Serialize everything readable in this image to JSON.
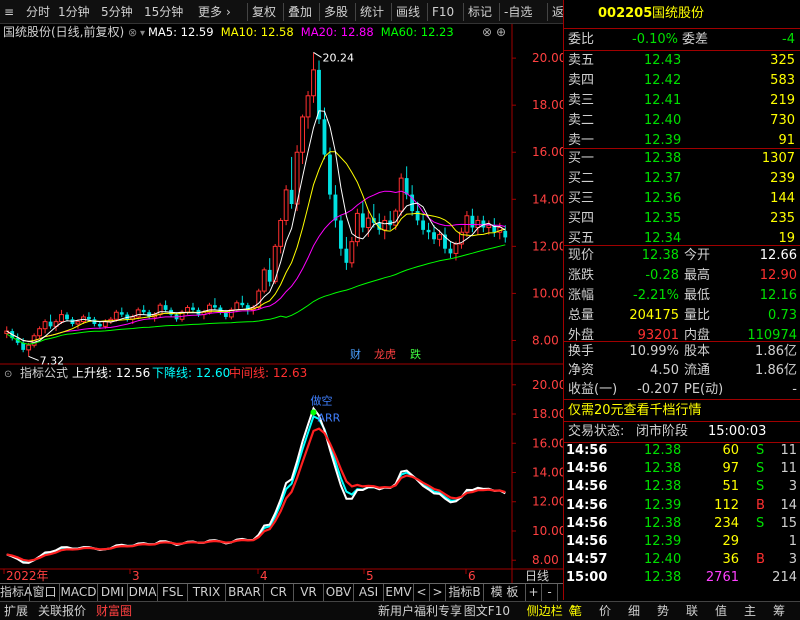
{
  "toolbar": {
    "left": [
      "分时",
      "1分钟",
      "5分钟",
      "15分钟",
      "更多"
    ],
    "right": [
      "复权",
      "叠加",
      "多股",
      "统计",
      "画线",
      "F10",
      "标记",
      "-自选",
      "返回"
    ]
  },
  "main_chart": {
    "title": "国统股份(日线,前复权)",
    "ma": [
      {
        "label": "MA5:",
        "value": "12.59",
        "color": "#ffffff"
      },
      {
        "label": "MA10:",
        "value": "12.58",
        "color": "#ffff00"
      },
      {
        "label": "MA20:",
        "value": "12.88",
        "color": "#ff00ff"
      },
      {
        "label": "MA60:",
        "value": "12.23",
        "color": "#00ff00"
      }
    ],
    "y_ticks": [
      "20.00",
      "18.00",
      "16.00",
      "14.00",
      "12.00",
      "10.00",
      "8.00"
    ],
    "high_label": "20.24",
    "low_label": "7.32",
    "badges": [
      {
        "text": "财",
        "color": "#4aa0ff"
      },
      {
        "text": "龙虎",
        "color": "#ff4040"
      },
      {
        "text": "跌",
        "color": "#40ff40"
      }
    ]
  },
  "indicator": {
    "name": "指标公式",
    "up_label": "上升线:",
    "up_value": "12.56",
    "down_label": "下降线:",
    "down_value": "12.60",
    "mid_label": "中间线:",
    "mid_value": "12.63",
    "y_ticks": [
      "20.00",
      "18.00",
      "16.00",
      "14.00",
      "12.00",
      "10.00",
      "8.00"
    ],
    "annot1": "做空",
    "annot2": "ARR"
  },
  "x_axis": {
    "labels": [
      "2022年",
      "3",
      "4",
      "5",
      "6"
    ],
    "period_button": "日线"
  },
  "tabs": [
    "指标A",
    "窗口",
    "MACD",
    "DMI",
    "DMA",
    "FSL",
    "TRIX",
    "BRAR",
    "CR",
    "VR",
    "OBV",
    "ASI",
    "EMV",
    "<",
    ">",
    "指标B",
    "模 板",
    "+",
    "-"
  ],
  "status_left": [
    "扩展",
    "关联报价",
    "财富圈"
  ],
  "status_mid": [
    "新用户福利专享",
    "图文F10",
    "侧边栏《"
  ],
  "status_right": [
    "笔",
    "价",
    "细",
    "势",
    "联",
    "值",
    "主",
    "筹"
  ],
  "quote": {
    "code": "002205",
    "name": "国统股份",
    "weibi_label": "委比",
    "weibi_value": "-0.10%",
    "weicha_label": "委差",
    "weicha_value": "-4",
    "sell": [
      {
        "label": "卖五",
        "price": "12.43",
        "vol": "325"
      },
      {
        "label": "卖四",
        "price": "12.42",
        "vol": "583"
      },
      {
        "label": "卖三",
        "price": "12.41",
        "vol": "219"
      },
      {
        "label": "卖二",
        "price": "12.40",
        "vol": "730"
      },
      {
        "label": "卖一",
        "price": "12.39",
        "vol": "91"
      }
    ],
    "buy": [
      {
        "label": "买一",
        "price": "12.38",
        "vol": "1307"
      },
      {
        "label": "买二",
        "price": "12.37",
        "vol": "239"
      },
      {
        "label": "买三",
        "price": "12.36",
        "vol": "144"
      },
      {
        "label": "买四",
        "price": "12.35",
        "vol": "235"
      },
      {
        "label": "买五",
        "price": "12.34",
        "vol": "19"
      }
    ],
    "stats": [
      {
        "l1": "现价",
        "v1": "12.38",
        "c1": "#00e000",
        "l2": "今开",
        "v2": "12.66",
        "c2": "#ffffff"
      },
      {
        "l1": "涨跌",
        "v1": "-0.28",
        "c1": "#00e000",
        "l2": "最高",
        "v2": "12.90",
        "c2": "#ff3030"
      },
      {
        "l1": "涨幅",
        "v1": "-2.21%",
        "c1": "#00e000",
        "l2": "最低",
        "v2": "12.16",
        "c2": "#00e000"
      },
      {
        "l1": "总量",
        "v1": "204175",
        "c1": "#ffff00",
        "l2": "量比",
        "v2": "0.73",
        "c2": "#00e000"
      },
      {
        "l1": "外盘",
        "v1": "93201",
        "c1": "#ff3030",
        "l2": "内盘",
        "v2": "110974",
        "c2": "#00e000"
      }
    ],
    "stats2": [
      {
        "l1": "换手",
        "v1": "10.99%",
        "l2": "股本",
        "v2": "1.86亿"
      },
      {
        "l1": "净资",
        "v1": "4.50",
        "l2": "流通",
        "v2": "1.86亿"
      },
      {
        "l1": "收益(一)",
        "v1": "-0.207",
        "l2": "PE(动)",
        "v2": "-"
      }
    ],
    "promo": "仅需20元查看千档行情",
    "trade_status_label": "交易状态:",
    "trade_status_value": "闭市阶段",
    "trade_time": "15:00:03",
    "ticks": [
      {
        "time": "14:56",
        "price": "12.38",
        "vol": "60",
        "side": "S"
      },
      {
        "time": "14:56",
        "price": "12.38",
        "vol": "97",
        "side": "S"
      },
      {
        "time": "14:56",
        "price": "12.38",
        "vol": "51",
        "side": "S"
      },
      {
        "time": "14:56",
        "price": "12.39",
        "vol": "112",
        "side": "B"
      },
      {
        "time": "14:56",
        "price": "12.38",
        "vol": "234",
        "side": "S"
      },
      {
        "time": "14:56",
        "price": "12.39",
        "vol": "29",
        "side": ""
      },
      {
        "time": "14:57",
        "price": "12.40",
        "vol": "36",
        "side": "B"
      },
      {
        "time": "15:00",
        "price": "12.38",
        "vol": "2761",
        "side": "214"
      }
    ],
    "tick_extra": [
      "11",
      "11",
      "3",
      "14",
      "15",
      "1",
      "3",
      ""
    ]
  },
  "chart_data": {
    "type": "candlestick",
    "y_range_main": [
      7.0,
      20.6
    ],
    "y_range_indicator": [
      7.4,
      20.6
    ],
    "candles": [
      [
        8.3,
        8.6,
        8.1,
        8.4
      ],
      [
        8.4,
        8.5,
        8.0,
        8.1
      ],
      [
        8.1,
        8.3,
        7.8,
        7.9
      ],
      [
        7.9,
        8.1,
        7.5,
        7.6
      ],
      [
        7.6,
        7.9,
        7.32,
        7.8
      ],
      [
        7.8,
        8.3,
        7.7,
        8.2
      ],
      [
        8.2,
        8.6,
        8.1,
        8.5
      ],
      [
        8.5,
        8.9,
        8.3,
        8.8
      ],
      [
        8.8,
        9.1,
        8.5,
        8.6
      ],
      [
        8.6,
        8.9,
        8.4,
        8.8
      ],
      [
        8.8,
        9.3,
        8.7,
        9.1
      ],
      [
        9.1,
        9.2,
        8.8,
        8.9
      ],
      [
        8.9,
        9.0,
        8.6,
        8.7
      ],
      [
        8.7,
        8.9,
        8.5,
        8.8
      ],
      [
        8.8,
        9.1,
        8.7,
        9.0
      ],
      [
        9.0,
        9.2,
        8.8,
        8.9
      ],
      [
        8.9,
        9.0,
        8.6,
        8.7
      ],
      [
        8.7,
        8.8,
        8.5,
        8.6
      ],
      [
        8.6,
        8.9,
        8.5,
        8.8
      ],
      [
        8.8,
        9.0,
        8.7,
        8.9
      ],
      [
        8.9,
        9.3,
        8.8,
        9.2
      ],
      [
        9.2,
        9.4,
        9.0,
        9.1
      ],
      [
        9.1,
        9.2,
        8.8,
        8.9
      ],
      [
        8.9,
        9.1,
        8.7,
        9.0
      ],
      [
        9.0,
        9.4,
        8.9,
        9.3
      ],
      [
        9.3,
        9.5,
        9.1,
        9.2
      ],
      [
        9.2,
        9.3,
        8.9,
        9.0
      ],
      [
        9.0,
        9.2,
        8.8,
        9.1
      ],
      [
        9.1,
        9.6,
        9.0,
        9.5
      ],
      [
        9.5,
        9.7,
        9.2,
        9.3
      ],
      [
        9.3,
        9.4,
        9.0,
        9.1
      ],
      [
        9.1,
        9.2,
        8.8,
        8.9
      ],
      [
        8.9,
        9.3,
        8.8,
        9.2
      ],
      [
        9.2,
        9.5,
        9.1,
        9.4
      ],
      [
        9.4,
        9.6,
        9.2,
        9.3
      ],
      [
        9.3,
        9.4,
        9.0,
        9.1
      ],
      [
        9.1,
        9.3,
        8.9,
        9.2
      ],
      [
        9.2,
        9.6,
        9.1,
        9.5
      ],
      [
        9.5,
        9.8,
        9.3,
        9.4
      ],
      [
        9.4,
        9.5,
        9.1,
        9.2
      ],
      [
        9.2,
        9.3,
        8.9,
        9.0
      ],
      [
        9.0,
        9.4,
        8.9,
        9.3
      ],
      [
        9.3,
        9.7,
        9.2,
        9.6
      ],
      [
        9.6,
        9.9,
        9.4,
        9.5
      ],
      [
        9.5,
        9.6,
        9.1,
        9.3
      ],
      [
        9.3,
        9.5,
        9.1,
        9.4
      ],
      [
        9.4,
        10.2,
        9.3,
        10.1
      ],
      [
        10.1,
        11.1,
        10.0,
        11.0
      ],
      [
        11.0,
        11.5,
        10.3,
        10.5
      ],
      [
        10.5,
        12.1,
        10.4,
        12.0
      ],
      [
        12.0,
        13.2,
        11.7,
        13.1
      ],
      [
        13.1,
        14.6,
        12.9,
        14.4
      ],
      [
        14.4,
        15.8,
        13.6,
        13.8
      ],
      [
        13.8,
        16.3,
        13.5,
        16.0
      ],
      [
        16.0,
        17.6,
        15.5,
        17.5
      ],
      [
        17.5,
        18.6,
        17.0,
        18.4
      ],
      [
        18.4,
        20.24,
        18.1,
        19.5
      ],
      [
        19.5,
        19.9,
        17.2,
        17.4
      ],
      [
        17.4,
        17.9,
        15.7,
        15.9
      ],
      [
        15.9,
        16.2,
        14.0,
        14.2
      ],
      [
        14.2,
        14.6,
        12.8,
        13.1
      ],
      [
        13.1,
        13.3,
        11.6,
        11.9
      ],
      [
        11.9,
        12.4,
        11.0,
        11.3
      ],
      [
        11.3,
        12.4,
        11.1,
        12.2
      ],
      [
        12.2,
        13.6,
        12.0,
        13.4
      ],
      [
        13.4,
        13.9,
        12.6,
        12.8
      ],
      [
        12.8,
        13.5,
        12.4,
        13.2
      ],
      [
        13.2,
        13.8,
        12.8,
        13.0
      ],
      [
        13.0,
        13.4,
        12.5,
        12.7
      ],
      [
        12.7,
        13.3,
        12.3,
        13.1
      ],
      [
        13.1,
        13.5,
        12.7,
        12.9
      ],
      [
        12.9,
        13.6,
        12.7,
        13.5
      ],
      [
        13.5,
        15.1,
        13.3,
        14.9
      ],
      [
        14.9,
        15.4,
        14.0,
        14.2
      ],
      [
        14.2,
        14.6,
        13.3,
        13.5
      ],
      [
        13.5,
        13.9,
        12.9,
        13.1
      ],
      [
        13.1,
        13.4,
        12.5,
        12.7
      ],
      [
        12.7,
        13.0,
        12.3,
        12.6
      ],
      [
        12.6,
        12.9,
        12.1,
        12.3
      ],
      [
        12.3,
        12.7,
        12.0,
        12.5
      ],
      [
        12.5,
        12.8,
        11.7,
        11.9
      ],
      [
        11.9,
        12.2,
        11.5,
        11.7
      ],
      [
        11.7,
        12.2,
        11.4,
        12.1
      ],
      [
        12.1,
        12.8,
        11.9,
        12.6
      ],
      [
        12.6,
        13.5,
        12.4,
        13.3
      ],
      [
        13.3,
        13.6,
        12.6,
        12.8
      ],
      [
        12.8,
        13.3,
        12.5,
        13.1
      ],
      [
        13.1,
        13.3,
        12.6,
        12.8
      ],
      [
        12.8,
        13.1,
        12.5,
        12.9
      ],
      [
        12.9,
        13.2,
        12.4,
        12.6
      ],
      [
        12.6,
        13.0,
        12.3,
        12.8
      ],
      [
        12.66,
        12.9,
        12.16,
        12.38
      ]
    ],
    "ma5_last": 12.59,
    "ma10_last": 12.58,
    "ma20_last": 12.88,
    "ma60_last": 12.23
  }
}
